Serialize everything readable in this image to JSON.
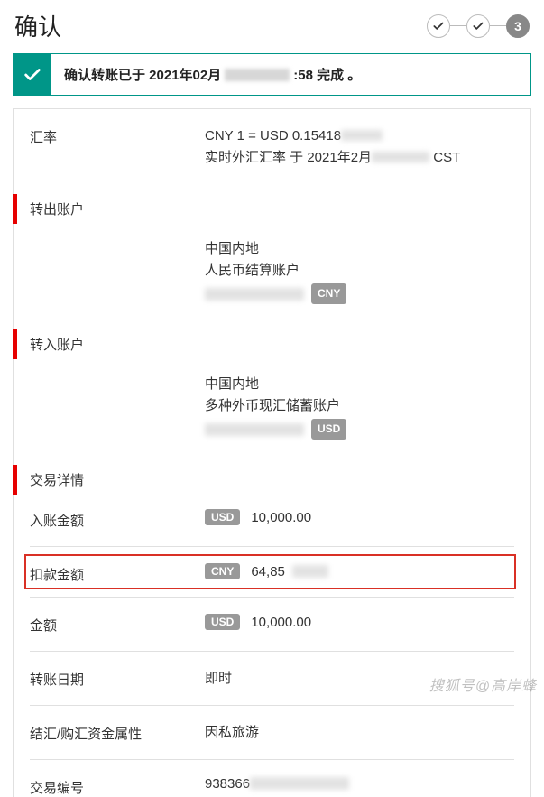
{
  "header": {
    "title": "确认",
    "stepper": {
      "step3_label": "3"
    }
  },
  "alert": {
    "prefix": "确认转账已于 2021年02月",
    "suffix": ":58 完成 。"
  },
  "rate": {
    "label": "汇率",
    "line1_prefix": "CNY 1 = USD 0.15418",
    "line2_prefix": "实时外汇汇率 于 2021年2月",
    "line2_suffix": " CST"
  },
  "transfer_out": {
    "heading": "转出账户",
    "region": "中国内地",
    "acctType": "人民币结算账户",
    "currency": "CNY"
  },
  "transfer_in": {
    "heading": "转入账户",
    "region": "中国内地",
    "acctType": "多种外币现汇储蓄账户",
    "currency": "USD"
  },
  "tx": {
    "heading": "交易详情",
    "credit": {
      "label": "入账金额",
      "currency": "USD",
      "value": "10,000.00"
    },
    "debit": {
      "label": "扣款金额",
      "currency": "CNY",
      "value_prefix": "64,85"
    },
    "amount": {
      "label": "金额",
      "currency": "USD",
      "value": "10,000.00"
    },
    "date": {
      "label": "转账日期",
      "value": "即时"
    },
    "purpose": {
      "label": "结汇/购汇资金属性",
      "value": "因私旅游"
    },
    "txnid": {
      "label": "交易编号",
      "value_prefix": "938366"
    }
  },
  "watermark": "搜狐号@高岸蜂"
}
